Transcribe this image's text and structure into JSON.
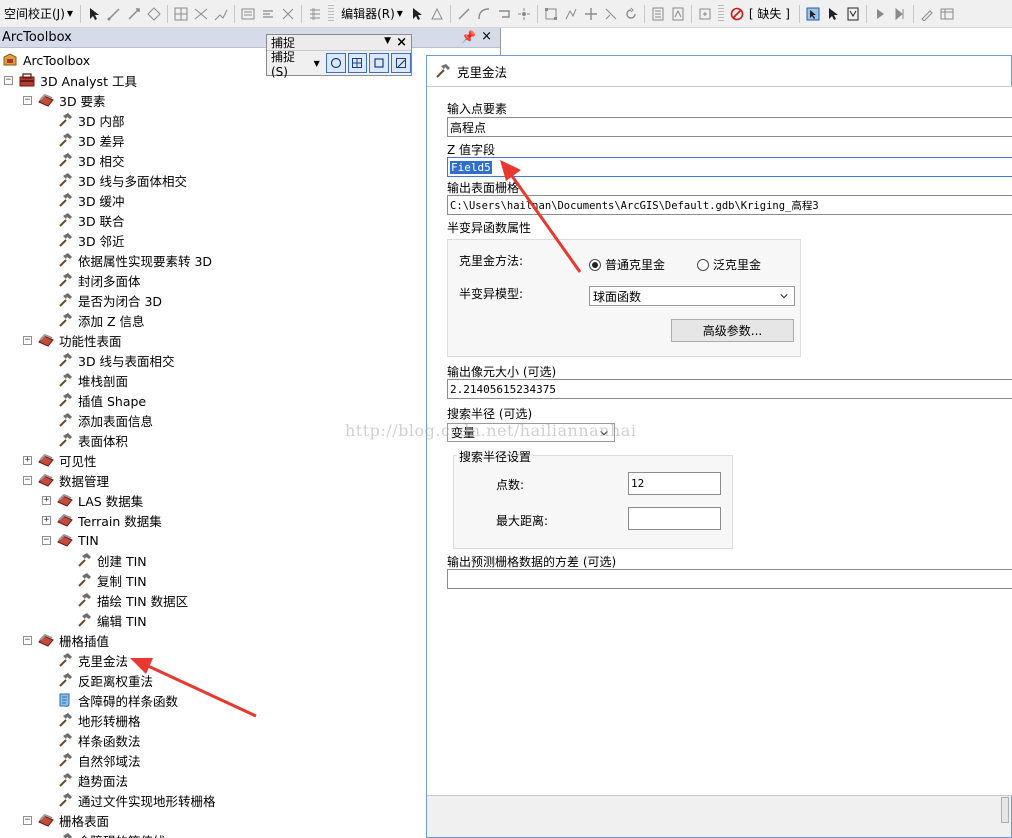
{
  "toolbar": {
    "spatial_adjust": "空间校正(J)",
    "editor": "编辑器(R)",
    "missing": "[ 缺失 ]"
  },
  "toolbox": {
    "title": "ArcToolbox",
    "pin": "ᵰ",
    "close": "×"
  },
  "tree": {
    "root": "ArcToolbox",
    "analyst": "3D Analyst 工具",
    "g_3d": "3D 要素",
    "t_3d": [
      "3D 内部",
      "3D 差异",
      "3D 相交",
      "3D 线与多面体相交",
      "3D 缓冲",
      "3D 联合",
      "3D 邻近",
      "依据属性实现要素转 3D",
      "封闭多面体",
      "是否为闭合 3D",
      "添加 Z 信息"
    ],
    "g_func": "功能性表面",
    "t_func": [
      "3D 线与表面相交",
      "堆栈剖面",
      "插值 Shape",
      "添加表面信息",
      "表面体积"
    ],
    "g_vis": "可见性",
    "g_dm": "数据管理",
    "g_las": "LAS 数据集",
    "g_terrain": "Terrain 数据集",
    "g_tin": "TIN",
    "t_tin": [
      "创建 TIN",
      "复制 TIN",
      "描绘 TIN 数据区",
      "编辑 TIN"
    ],
    "g_raster": "栅格插值",
    "t_raster": [
      "克里金法",
      "反距离权重法",
      "含障碍的样条函数",
      "地形转栅格",
      "样条函数法",
      "自然邻域法",
      "趋势面法",
      "通过文件实现地形转栅格"
    ],
    "g_surface": "栅格表面",
    "t_surface_partial": "含障碍的等值线"
  },
  "snapping": {
    "title": "捕捉",
    "menu": "捕捉(S)"
  },
  "dialog": {
    "title": "克里金法",
    "input_label": "输入点要素",
    "input_value": "高程点",
    "z_label": "Z 值字段",
    "z_value": "Field5",
    "output_label": "输出表面栅格",
    "output_value": "C:\\Users\\hailnan\\Documents\\ArcGIS\\Default.gdb\\Kriging_高程3",
    "semivar_label": "半变异函数属性",
    "method_label": "克里金方法:",
    "method_ordinary": "普通克里金",
    "method_universal": "泛克里金",
    "model_label": "半变异模型:",
    "model_value": "球面函数",
    "advanced_button": "高级参数...",
    "cellsize_label": "输出像元大小 (可选)",
    "cellsize_value": "2.21405615234375",
    "radius_label": "搜索半径 (可选)",
    "radius_value": "变量",
    "radius_settings_label": "搜索半径设置",
    "points_label": "点数:",
    "points_value": "12",
    "maxdist_label": "最大距离:",
    "maxdist_value": "",
    "variance_label": "输出预测栅格数据的方差 (可选)",
    "variance_value": ""
  },
  "watermark": "http://blog.csdn.net/hailiannanhai"
}
